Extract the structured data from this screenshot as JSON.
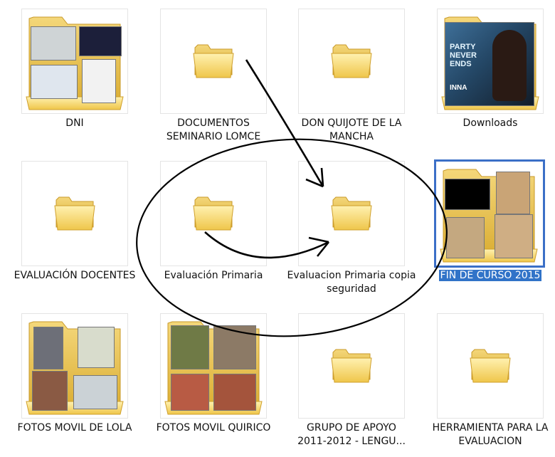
{
  "view": {
    "folders": [
      {
        "name": "DNI"
      },
      {
        "name": "DOCUMENTOS\nSEMINARIO LOMCE"
      },
      {
        "name": "DON QUIJOTE DE LA\nMANCHA"
      },
      {
        "name": "Downloads",
        "cover_text": [
          "PARTY",
          "NEVER",
          "ENDS",
          "INNA"
        ]
      },
      {
        "name": "EVALUACIÓN DOCENTES"
      },
      {
        "name": "Evaluación Primaria"
      },
      {
        "name": "Evaluacion Primaria copia\nseguridad"
      },
      {
        "name": "FIN DE CURSO 2015",
        "selected": true
      },
      {
        "name": "FOTOS MOVIL DE LOLA"
      },
      {
        "name": "FOTOS MOVIL QUIRICO"
      },
      {
        "name": "GRUPO DE APOYO\n2011-2012 - LENGU..."
      },
      {
        "name": "HERRAMIENTA PARA LA\nEVALUACION"
      }
    ]
  },
  "colors": {
    "selection": "#3173c8",
    "folder_yellow": "#f6d874",
    "annotation": "#000000"
  },
  "icons": {
    "empty_folder": "folder-icon",
    "photo_folder": "folder-thumbnail-icon"
  }
}
